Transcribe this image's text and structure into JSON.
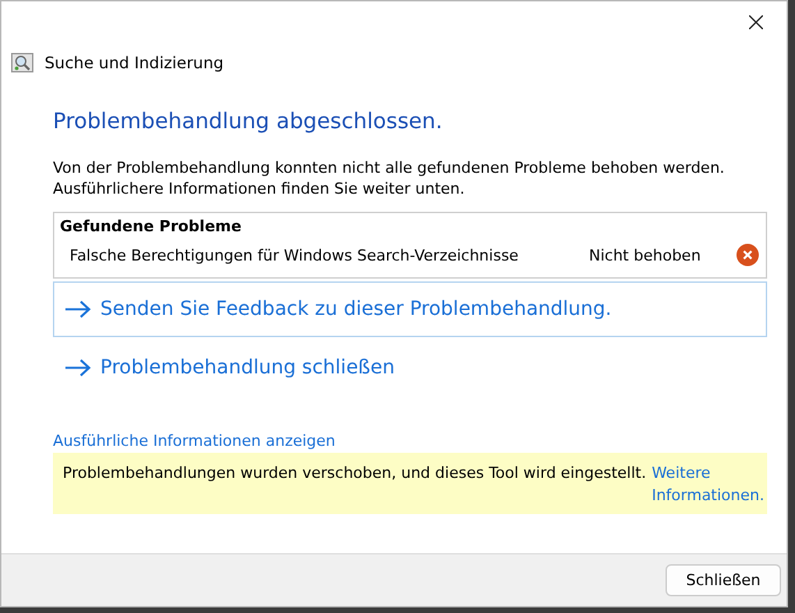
{
  "window": {
    "title": "Suche und Indizierung"
  },
  "heading": "Problembehandlung abgeschlossen.",
  "description": "Von der Problembehandlung konnten nicht alle gefundenen Probleme behoben werden. Ausführlichere Informationen finden Sie weiter unten.",
  "problems": {
    "title": "Gefundene Probleme",
    "items": [
      {
        "name": "Falsche Berechtigungen für Windows Search-Verzeichnisse",
        "status": "Nicht behoben",
        "fixed": false
      }
    ]
  },
  "actions": [
    {
      "label": "Senden Sie Feedback zu dieser Problembehandlung.",
      "selected": true
    },
    {
      "label": "Problembehandlung schließen",
      "selected": false
    }
  ],
  "details_link": "Ausführliche Informationen anzeigen",
  "notice": {
    "text": "Problembehandlungen wurden verschoben, und dieses Tool wird eingestellt.",
    "link": "Weitere Informationen."
  },
  "buttons": [
    "Schließen"
  ]
}
